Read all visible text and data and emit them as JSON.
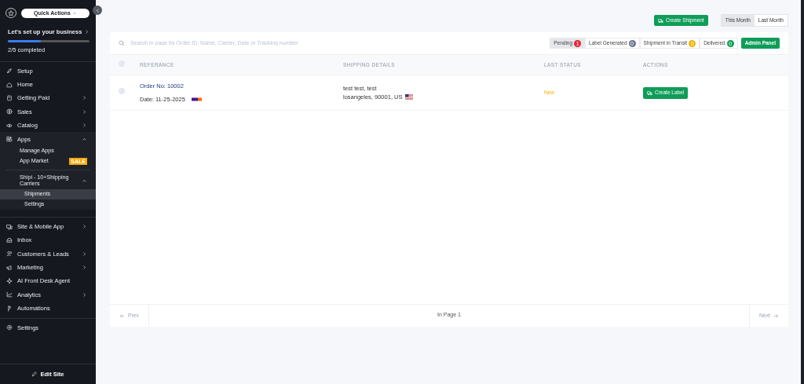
{
  "sidebar": {
    "quick_actions": "Quick Actions",
    "setup": {
      "title": "Let's set up your business",
      "level": 0.4,
      "progress_text": "2/5 completed"
    },
    "groups": [
      [
        {
          "label": "Setup"
        },
        {
          "label": "Home"
        },
        {
          "label": "Getting Paid",
          "expanded": false
        },
        {
          "label": "Sales",
          "expanded": false
        },
        {
          "label": "Catalog",
          "expanded": false
        },
        {
          "label": "Apps",
          "expanded": true,
          "children": [
            {
              "label": "Manage Apps"
            },
            {
              "label": "App Market",
              "badge": "SALE"
            },
            {
              "label": "Shipi - 10+Shipping Carriers",
              "expanded": true,
              "children": [
                {
                  "label": "Shipments",
                  "selected": true
                },
                {
                  "label": "Settings",
                  "selected": false
                }
              ]
            }
          ]
        }
      ],
      [
        {
          "label": "Site & Mobile App",
          "expanded": false
        },
        {
          "label": "Inbox"
        },
        {
          "label": "Customers & Leads",
          "expanded": false
        },
        {
          "label": "Marketing",
          "expanded": false
        },
        {
          "label": "AI Front Desk Agent"
        },
        {
          "label": "Analytics",
          "expanded": false
        },
        {
          "label": "Automations"
        }
      ],
      [
        {
          "label": "Settings"
        }
      ]
    ],
    "footer": "Edit Site"
  },
  "toolbar": {
    "create_shipment": "Create Shipment",
    "periods": [
      {
        "label": "This Month",
        "selected": true
      },
      {
        "label": "Last Month",
        "selected": false
      }
    ]
  },
  "search": {
    "placeholder": "Search in page by Order ID, Name, Carrier, Date or Tracking number"
  },
  "filters": [
    {
      "label": "Pending",
      "count": "1",
      "color": "#e5243b",
      "selected": true
    },
    {
      "label": "Label Generated",
      "count": "0",
      "color": "#6b7794",
      "selected": false
    },
    {
      "label": "Shipment in Transit",
      "count": "0",
      "color": "#f4b400",
      "selected": false
    },
    {
      "label": "Delivered",
      "count": "0",
      "color": "#0f9d58",
      "selected": false
    }
  ],
  "admin_panel": "Admin Panel",
  "table": {
    "select_all_checked": false,
    "columns": [
      "REFERANCE",
      "SHIPPING DETAILS",
      "LAST STATUS",
      "ACTIONS"
    ],
    "rows": [
      {
        "checked": false,
        "order": "Order No: 10002",
        "date": "Date: 11-25-2025",
        "address_line_1": "test test, test",
        "address_line_2": "losangeles, 90001, US",
        "status": "New",
        "action": "Create Label"
      }
    ]
  },
  "pagination": {
    "prev": "Prev",
    "page": "In Page 1",
    "next": "Next"
  }
}
